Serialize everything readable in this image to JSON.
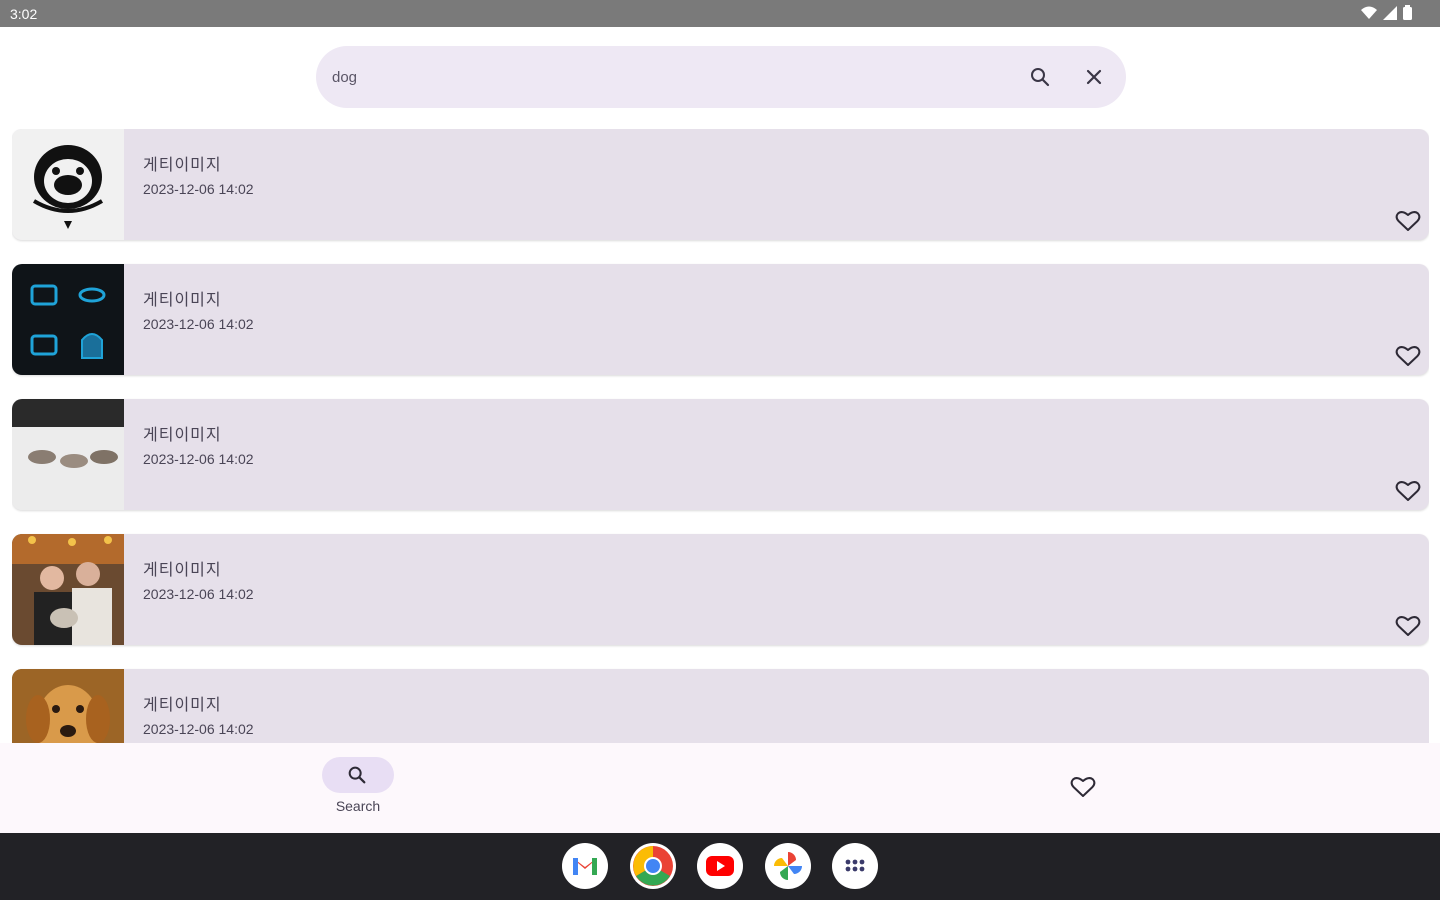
{
  "status_bar": {
    "time": "3:02"
  },
  "search": {
    "value": "dog",
    "placeholder": ""
  },
  "results": [
    {
      "title": "게티이미지",
      "date": "2023-12-06 14:02",
      "thumbnail": "bulldog-emblem"
    },
    {
      "title": "게티이미지",
      "date": "2023-12-06 14:02",
      "thumbnail": "neon-icons"
    },
    {
      "title": "게티이미지",
      "date": "2023-12-06 14:02",
      "thumbnail": "sled-dogs"
    },
    {
      "title": "게티이미지",
      "date": "2023-12-06 14:02",
      "thumbnail": "couple-with-dog"
    },
    {
      "title": "게티이미지",
      "date": "2023-12-06 14:02",
      "thumbnail": "golden-dog"
    }
  ],
  "bottom_nav": {
    "search_label": "Search"
  },
  "dock": {
    "apps": [
      "gmail-icon",
      "chrome-icon",
      "youtube-icon",
      "photos-icon",
      "app-drawer-icon"
    ]
  },
  "colors": {
    "accent": "#e8def4",
    "card": "#e6e0ea",
    "search_bg": "#eee8f4"
  }
}
